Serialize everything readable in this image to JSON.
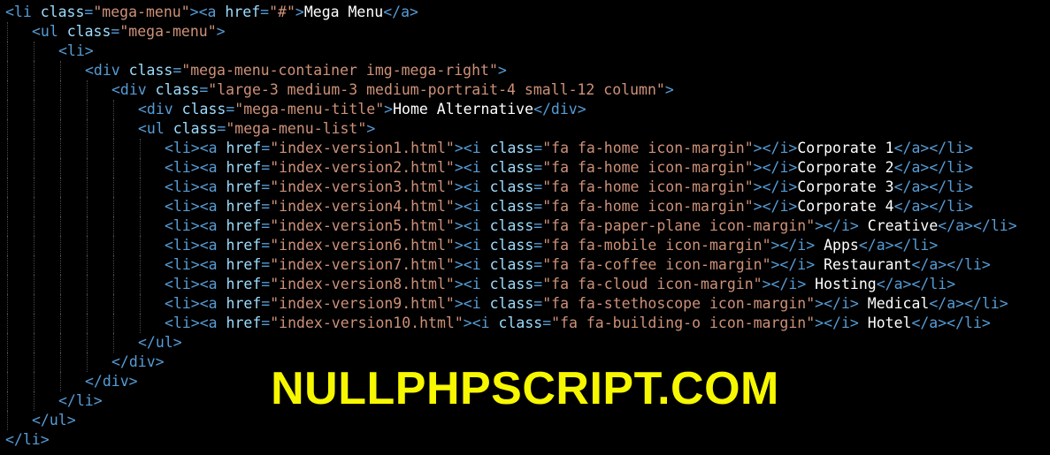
{
  "colors": {
    "background": "#000000",
    "tag": "#569cd6",
    "attribute": "#9cdcfe",
    "string": "#ce9178",
    "text": "#ffffff",
    "watermark": "#f7f700"
  },
  "code_lines": [
    {
      "indent": 0,
      "tokens": [
        [
          "tag",
          "<li "
        ],
        [
          "attr",
          "class"
        ],
        [
          "tag",
          "="
        ],
        [
          "str",
          "\"mega-menu\""
        ],
        [
          "tag",
          "><a "
        ],
        [
          "attr",
          "href"
        ],
        [
          "tag",
          "="
        ],
        [
          "str",
          "\"#\""
        ],
        [
          "tag",
          ">"
        ],
        [
          "text",
          "Mega Menu"
        ],
        [
          "tag",
          "</a>"
        ]
      ]
    },
    {
      "indent": 1,
      "tokens": [
        [
          "tag",
          "<ul "
        ],
        [
          "attr",
          "class"
        ],
        [
          "tag",
          "="
        ],
        [
          "str",
          "\"mega-menu\""
        ],
        [
          "tag",
          ">"
        ]
      ]
    },
    {
      "indent": 2,
      "tokens": [
        [
          "tag",
          "<li>"
        ]
      ]
    },
    {
      "indent": 3,
      "tokens": [
        [
          "tag",
          "<div "
        ],
        [
          "attr",
          "class"
        ],
        [
          "tag",
          "="
        ],
        [
          "str",
          "\"mega-menu-container img-mega-right\""
        ],
        [
          "tag",
          ">"
        ]
      ]
    },
    {
      "indent": 4,
      "tokens": [
        [
          "tag",
          "<div "
        ],
        [
          "attr",
          "class"
        ],
        [
          "tag",
          "="
        ],
        [
          "str",
          "\"large-3 medium-3 medium-portrait-4 small-12 column\""
        ],
        [
          "tag",
          ">"
        ]
      ]
    },
    {
      "indent": 5,
      "tokens": [
        [
          "tag",
          "<div "
        ],
        [
          "attr",
          "class"
        ],
        [
          "tag",
          "="
        ],
        [
          "str",
          "\"mega-menu-title\""
        ],
        [
          "tag",
          ">"
        ],
        [
          "text",
          "Home Alternative"
        ],
        [
          "tag",
          "</div>"
        ]
      ]
    },
    {
      "indent": 5,
      "tokens": [
        [
          "tag",
          "<ul "
        ],
        [
          "attr",
          "class"
        ],
        [
          "tag",
          "="
        ],
        [
          "str",
          "\"mega-menu-list\""
        ],
        [
          "tag",
          ">"
        ]
      ]
    },
    {
      "indent": 6,
      "tokens": [
        [
          "tag",
          "<li><a "
        ],
        [
          "attr",
          "href"
        ],
        [
          "tag",
          "="
        ],
        [
          "str",
          "\"index-version1.html\""
        ],
        [
          "tag",
          "><i "
        ],
        [
          "attr",
          "class"
        ],
        [
          "tag",
          "="
        ],
        [
          "str",
          "\"fa fa-home icon-margin\""
        ],
        [
          "tag",
          "></i>"
        ],
        [
          "text",
          "Corporate 1"
        ],
        [
          "tag",
          "</a></li>"
        ]
      ]
    },
    {
      "indent": 6,
      "tokens": [
        [
          "tag",
          "<li><a "
        ],
        [
          "attr",
          "href"
        ],
        [
          "tag",
          "="
        ],
        [
          "str",
          "\"index-version2.html\""
        ],
        [
          "tag",
          "><i "
        ],
        [
          "attr",
          "class"
        ],
        [
          "tag",
          "="
        ],
        [
          "str",
          "\"fa fa-home icon-margin\""
        ],
        [
          "tag",
          "></i>"
        ],
        [
          "text",
          "Corporate 2"
        ],
        [
          "tag",
          "</a></li>"
        ]
      ]
    },
    {
      "indent": 6,
      "tokens": [
        [
          "tag",
          "<li><a "
        ],
        [
          "attr",
          "href"
        ],
        [
          "tag",
          "="
        ],
        [
          "str",
          "\"index-version3.html\""
        ],
        [
          "tag",
          "><i "
        ],
        [
          "attr",
          "class"
        ],
        [
          "tag",
          "="
        ],
        [
          "str",
          "\"fa fa-home icon-margin\""
        ],
        [
          "tag",
          "></i>"
        ],
        [
          "text",
          "Corporate 3"
        ],
        [
          "tag",
          "</a></li>"
        ]
      ]
    },
    {
      "indent": 6,
      "tokens": [
        [
          "tag",
          "<li><a "
        ],
        [
          "attr",
          "href"
        ],
        [
          "tag",
          "="
        ],
        [
          "str",
          "\"index-version4.html\""
        ],
        [
          "tag",
          "><i "
        ],
        [
          "attr",
          "class"
        ],
        [
          "tag",
          "="
        ],
        [
          "str",
          "\"fa fa-home icon-margin\""
        ],
        [
          "tag",
          "></i>"
        ],
        [
          "text",
          "Corporate 4"
        ],
        [
          "tag",
          "</a></li>"
        ]
      ]
    },
    {
      "indent": 6,
      "tokens": [
        [
          "tag",
          "<li><a "
        ],
        [
          "attr",
          "href"
        ],
        [
          "tag",
          "="
        ],
        [
          "str",
          "\"index-version5.html\""
        ],
        [
          "tag",
          "><i "
        ],
        [
          "attr",
          "class"
        ],
        [
          "tag",
          "="
        ],
        [
          "str",
          "\"fa fa-paper-plane icon-margin\""
        ],
        [
          "tag",
          "></i>"
        ],
        [
          "text",
          " Creative"
        ],
        [
          "tag",
          "</a></li>"
        ]
      ]
    },
    {
      "indent": 6,
      "tokens": [
        [
          "tag",
          "<li><a "
        ],
        [
          "attr",
          "href"
        ],
        [
          "tag",
          "="
        ],
        [
          "str",
          "\"index-version6.html\""
        ],
        [
          "tag",
          "><i "
        ],
        [
          "attr",
          "class"
        ],
        [
          "tag",
          "="
        ],
        [
          "str",
          "\"fa fa-mobile icon-margin\""
        ],
        [
          "tag",
          "></i>"
        ],
        [
          "text",
          " Apps"
        ],
        [
          "tag",
          "</a></li>"
        ]
      ]
    },
    {
      "indent": 6,
      "tokens": [
        [
          "tag",
          "<li><a "
        ],
        [
          "attr",
          "href"
        ],
        [
          "tag",
          "="
        ],
        [
          "str",
          "\"index-version7.html\""
        ],
        [
          "tag",
          "><i "
        ],
        [
          "attr",
          "class"
        ],
        [
          "tag",
          "="
        ],
        [
          "str",
          "\"fa fa-coffee icon-margin\""
        ],
        [
          "tag",
          "></i>"
        ],
        [
          "text",
          " Restaurant"
        ],
        [
          "tag",
          "</a></li>"
        ]
      ]
    },
    {
      "indent": 6,
      "tokens": [
        [
          "tag",
          "<li><a "
        ],
        [
          "attr",
          "href"
        ],
        [
          "tag",
          "="
        ],
        [
          "str",
          "\"index-version8.html\""
        ],
        [
          "tag",
          "><i "
        ],
        [
          "attr",
          "class"
        ],
        [
          "tag",
          "="
        ],
        [
          "str",
          "\"fa fa-cloud icon-margin\""
        ],
        [
          "tag",
          "></i>"
        ],
        [
          "text",
          " Hosting"
        ],
        [
          "tag",
          "</a></li>"
        ]
      ]
    },
    {
      "indent": 6,
      "tokens": [
        [
          "tag",
          "<li><a "
        ],
        [
          "attr",
          "href"
        ],
        [
          "tag",
          "="
        ],
        [
          "str",
          "\"index-version9.html\""
        ],
        [
          "tag",
          "><i "
        ],
        [
          "attr",
          "class"
        ],
        [
          "tag",
          "="
        ],
        [
          "str",
          "\"fa fa-stethoscope icon-margin\""
        ],
        [
          "tag",
          "></i>"
        ],
        [
          "text",
          " Medical"
        ],
        [
          "tag",
          "</a></li>"
        ]
      ]
    },
    {
      "indent": 6,
      "tokens": [
        [
          "tag",
          "<li><a "
        ],
        [
          "attr",
          "href"
        ],
        [
          "tag",
          "="
        ],
        [
          "str",
          "\"index-version10.html\""
        ],
        [
          "tag",
          "><i "
        ],
        [
          "attr",
          "class"
        ],
        [
          "tag",
          "="
        ],
        [
          "str",
          "\"fa fa-building-o icon-margin\""
        ],
        [
          "tag",
          "></i>"
        ],
        [
          "text",
          " Hotel"
        ],
        [
          "tag",
          "</a></li>"
        ]
      ]
    },
    {
      "indent": 5,
      "tokens": [
        [
          "tag",
          "</ul>"
        ]
      ]
    },
    {
      "indent": 4,
      "tokens": [
        [
          "tag",
          "</div>"
        ]
      ]
    },
    {
      "indent": 3,
      "tokens": [
        [
          "tag",
          "</div>"
        ]
      ]
    },
    {
      "indent": 2,
      "tokens": [
        [
          "tag",
          "</li>"
        ]
      ]
    },
    {
      "indent": 1,
      "tokens": [
        [
          "tag",
          "</ul>"
        ]
      ]
    },
    {
      "indent": 0,
      "tokens": [
        [
          "tag",
          "</li>"
        ]
      ]
    }
  ],
  "watermark": {
    "text": "NULLPHPSCRIPT.COM"
  }
}
